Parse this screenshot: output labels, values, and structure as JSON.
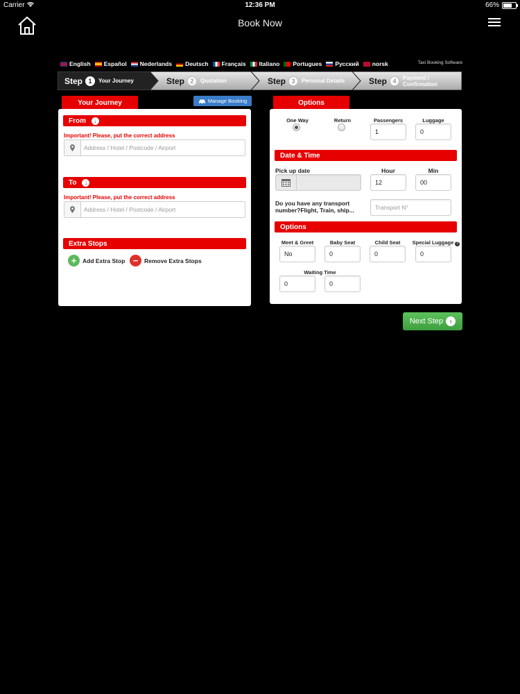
{
  "status_bar": {
    "carrier": "Carrier",
    "time": "12:36 PM",
    "battery": "66%"
  },
  "nav": {
    "title": "Book Now"
  },
  "languages": [
    {
      "label": "English",
      "flag_colors": [
        "#1b3a8a",
        "#c8102e"
      ]
    },
    {
      "label": "Español",
      "flag_colors": [
        "#c60b1e",
        "#ffc400"
      ]
    },
    {
      "label": "Nederlands",
      "flag_colors": [
        "#ae1c28",
        "#21468b"
      ]
    },
    {
      "label": "Deutsch",
      "flag_colors": [
        "#000000",
        "#dd0000"
      ]
    },
    {
      "label": "Français",
      "flag_colors": [
        "#0055a4",
        "#ef4135"
      ]
    },
    {
      "label": "Italiano",
      "flag_colors": [
        "#009246",
        "#ce2b37"
      ]
    },
    {
      "label": "Portugues",
      "flag_colors": [
        "#006600",
        "#ff0000"
      ]
    },
    {
      "label": "Русский",
      "flag_colors": [
        "#0039a6",
        "#d52b1e"
      ]
    },
    {
      "label": "norsk",
      "flag_colors": [
        "#ba0c2f",
        "#00205b"
      ]
    }
  ],
  "brand_text": "Taxi Booking Software",
  "steps": [
    {
      "word": "Step",
      "num": "1",
      "label": "Your Journey"
    },
    {
      "word": "Step",
      "num": "2",
      "label": "Quotation"
    },
    {
      "word": "Step",
      "num": "3",
      "label": "Personal Details"
    },
    {
      "word": "Step",
      "num": "4",
      "label": "Payment / Confirmation"
    }
  ],
  "journey": {
    "tab_label": "Your Journey",
    "manage_booking": "Manage Booking",
    "from_label": "From",
    "to_label": "To",
    "warning": "Important! Please, put the correct address",
    "address_placeholder": "Address / Hotel / Postcode / Airport",
    "extra_stops_label": "Extra Stops",
    "add_extra_stop": "Add Extra Stop",
    "remove_extra_stops": "Remove Extra Stops"
  },
  "options": {
    "tab_label": "Options",
    "one_way": "One Way",
    "return": "Return",
    "selected_trip": "one_way",
    "passengers_label": "Passengers",
    "passengers_value": "1",
    "luggage_label": "Luggage",
    "luggage_value": "0",
    "datetime_label": "Date & Time",
    "pickup_label": "Pick up date",
    "hour_label": "Hour",
    "hour_value": "12",
    "min_label": "Min",
    "min_value": "00",
    "transport_question": "Do you have any transport number?Flight, Train, ship...",
    "transport_placeholder": "Transport N°",
    "options_label": "Options",
    "meet_greet_label": "Meet & Greet",
    "meet_greet_value": "No",
    "baby_seat_label": "Baby Seat",
    "baby_seat_value": "0",
    "child_seat_label": "Child Seat",
    "child_seat_value": "0",
    "special_luggage_label": "Special Luggage",
    "special_luggage_value": "0",
    "waiting_time_label": "Waiting Time",
    "waiting_time_hours": "0",
    "waiting_time_minutes": "0"
  },
  "next_step": "Next Step",
  "colors": {
    "accent_red": "#e60000",
    "next_green": "#4caf50",
    "manage_blue": "#3a7cc8"
  }
}
